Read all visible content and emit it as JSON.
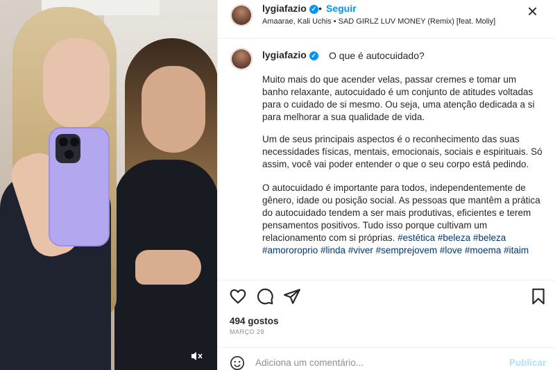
{
  "post": {
    "username": "lygiafazio",
    "follow_label": "Seguir",
    "dot": "•",
    "audio": "Amaarae, Kali Uchis • SAD GIRLZ LUV MONEY (Remix) [feat. Moliy]",
    "caption_title": "O que é autocuidado?",
    "caption_paragraphs": [
      "Muito mais do que acender velas, passar cremes e tomar um banho relaxante, autocuidado é um conjunto de atitudes voltadas para o cuidado de si mesmo. Ou seja, uma atenção dedicada a si para melhorar a sua qualidade de vida.",
      "Um de seus principais aspectos é o reconhecimento das suas necessidades físicas, mentais, emocionais, sociais e espirituais. Só assim, você vai poder entender o que o seu corpo está pedindo.",
      "O autocuidado é importante para todos, independentemente de gênero, idade ou posição social. As pessoas que mantêm a prática do autocuidado tendem a ser mais produtivas, eficientes e terem pensamentos positivos. Tudo isso porque cultivam um relacionamento com si próprias."
    ],
    "hashtags": "#estética #beleza #beleza #amororoprio #linda #viver #semprejovem #love #moema #itaim",
    "likes": "494 gostos",
    "date": "MARÇO 28"
  },
  "comment": {
    "placeholder": "Adiciona um comentário...",
    "post_label": "Publicar"
  },
  "icons": {
    "close": "close-icon",
    "like": "heart-icon",
    "comment": "comment-icon",
    "share": "share-icon",
    "save": "bookmark-icon",
    "emoji": "emoji-icon",
    "mute": "muted-speaker-icon",
    "verified": "verified-badge-icon"
  },
  "colors": {
    "accent": "#0095f6",
    "hashtag": "#00376b",
    "muted": "#8e8e8e",
    "post_disabled": "#b2dffc"
  }
}
